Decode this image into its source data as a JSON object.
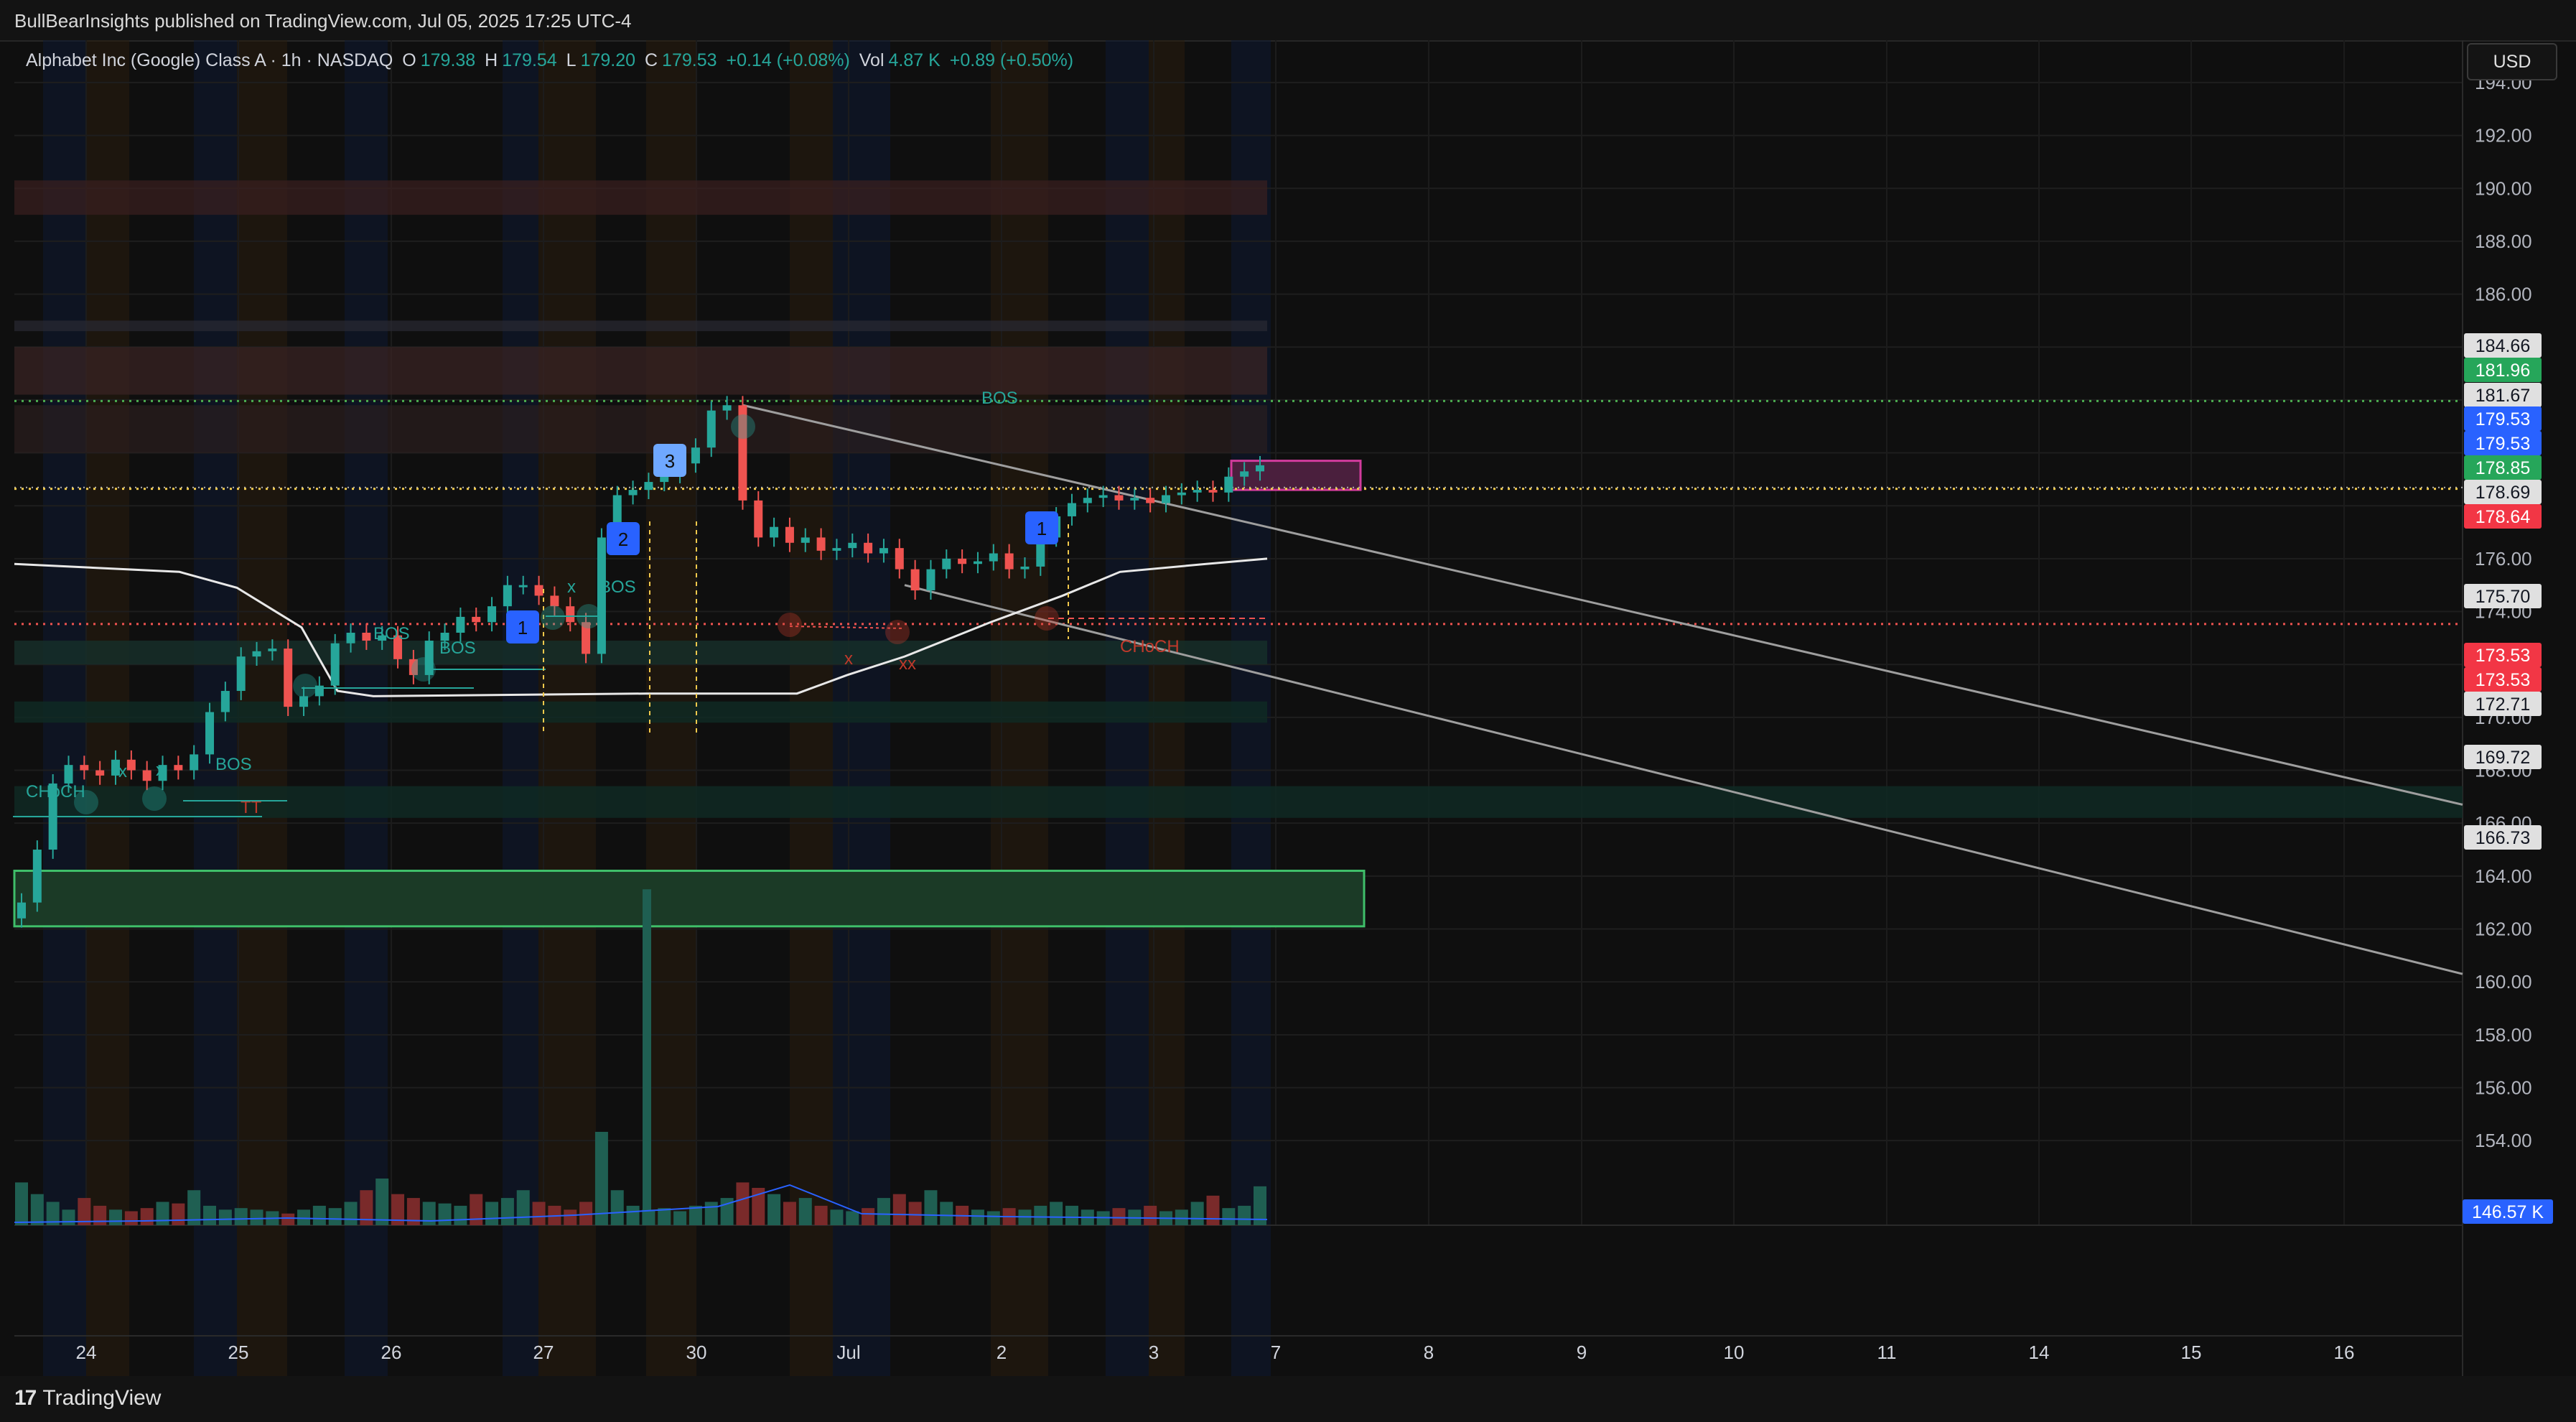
{
  "header": {
    "publisher": "BullBearInsights published on TradingView.com, Jul 05, 2025 17:25 UTC-4"
  },
  "legend": {
    "symbol": "Alphabet Inc (Google) Class A · 1h · NASDAQ",
    "o_label": "O",
    "o": "179.38",
    "h_label": "H",
    "h": "179.54",
    "l_label": "L",
    "l": "179.20",
    "c_label": "C",
    "c": "179.53",
    "change": "+0.14 (+0.08%)",
    "vol_label": "Vol",
    "vol": "4.87 K",
    "vol_change": "+0.89 (+0.50%)"
  },
  "currency": "USD",
  "footer": {
    "brand": "TradingView",
    "brand_mark": "17"
  },
  "colors": {
    "bg": "#0f0f0f",
    "up": "#26a69a",
    "down": "#ef5350",
    "blue": "#2962ff",
    "green_label": "#26a65a",
    "red_label": "#f23645",
    "grey_label": "#e0e0e0"
  },
  "chart_data": {
    "type": "candlestick",
    "ylim": [
      150.8,
      195.6
    ],
    "y_ticks": [
      "194.00",
      "192.00",
      "190.00",
      "188.00",
      "186.00",
      "184.00",
      "182.00",
      "180.00",
      "178.00",
      "176.00",
      "174.00",
      "172.00",
      "170.00",
      "168.00",
      "166.00",
      "164.00",
      "162.00",
      "160.00",
      "158.00",
      "156.00",
      "154.00"
    ],
    "x_ticks": [
      "24",
      "25",
      "26",
      "27",
      "30",
      "Jul",
      "2",
      "3",
      "7",
      "8",
      "9",
      "10",
      "11",
      "14",
      "15",
      "16"
    ],
    "price_labels": [
      {
        "value": "184.66",
        "style": "grey"
      },
      {
        "value": "181.96",
        "style": "green"
      },
      {
        "value": "181.67",
        "style": "grey"
      },
      {
        "value": "179.53",
        "style": "blue"
      },
      {
        "value": "179.53",
        "style": "blue"
      },
      {
        "value": "178.85",
        "style": "green"
      },
      {
        "value": "178.69",
        "style": "grey"
      },
      {
        "value": "178.64",
        "style": "red"
      },
      {
        "value": "175.70",
        "style": "grey"
      },
      {
        "value": "173.53",
        "style": "red"
      },
      {
        "value": "173.53",
        "style": "red"
      },
      {
        "value": "172.71",
        "style": "grey"
      },
      {
        "value": "169.72",
        "style": "grey"
      },
      {
        "value": "166.73",
        "style": "grey"
      }
    ],
    "volume_label": "146.57 K",
    "annotations": [
      {
        "text": "CHoCH",
        "color": "green"
      },
      {
        "text": "x",
        "color": "green"
      },
      {
        "text": "x",
        "color": "green"
      },
      {
        "text": "BOS",
        "color": "green"
      },
      {
        "text": "BOS",
        "color": "green"
      },
      {
        "text": "BOS",
        "color": "green"
      },
      {
        "text": "x",
        "color": "green"
      },
      {
        "text": "BOS",
        "color": "green"
      },
      {
        "text": "BOS",
        "color": "green"
      },
      {
        "text": "x",
        "color": "red"
      },
      {
        "text": "xx",
        "color": "red"
      },
      {
        "text": "CHoCH",
        "color": "red"
      },
      {
        "text": "TT",
        "color": "red"
      }
    ],
    "waves": [
      "1",
      "2",
      "3",
      "1"
    ],
    "price_path": [
      163,
      165,
      167.5,
      168.2,
      168,
      167.8,
      168.4,
      168,
      167.6,
      168.2,
      168,
      168.6,
      170.2,
      171,
      172.3,
      172.5,
      172.6,
      170.4,
      170.8,
      171.2,
      172.8,
      173.2,
      172.9,
      173.1,
      172.2,
      171.6,
      172.9,
      173.2,
      173.8,
      173.6,
      174.2,
      175,
      175,
      174.6,
      174.2,
      173.6,
      172.4,
      176.8,
      178.4,
      178.6,
      178.9,
      179.2,
      179.6,
      180.2,
      181.6,
      181.8,
      178.2,
      176.8,
      177.2,
      176.6,
      176.8,
      176.3,
      176.4,
      176.6,
      176.2,
      176.4,
      175.6,
      174.8,
      175.6,
      176,
      175.8,
      175.9,
      176.2,
      175.6,
      175.7,
      176.8,
      177.6,
      178.1,
      178.3,
      178.4,
      178.2,
      178.3,
      178.1,
      178.4,
      178.5,
      178.6,
      178.5,
      179.1,
      179.3,
      179.53
    ],
    "volume": [
      55,
      40,
      30,
      20,
      35,
      25,
      20,
      18,
      22,
      30,
      28,
      45,
      25,
      20,
      22,
      20,
      18,
      15,
      20,
      25,
      22,
      30,
      45,
      60,
      40,
      35,
      30,
      28,
      25,
      40,
      30,
      35,
      45,
      30,
      25,
      20,
      30,
      120,
      45,
      25,
      20,
      22,
      18,
      25,
      30,
      35,
      55,
      48,
      40,
      30,
      35,
      25,
      20,
      18,
      22,
      35,
      40,
      30,
      45,
      30,
      25,
      20,
      18,
      22,
      20,
      25,
      30,
      25,
      20,
      18,
      22,
      20,
      25,
      18,
      20,
      30,
      38,
      22,
      25,
      50
    ]
  }
}
